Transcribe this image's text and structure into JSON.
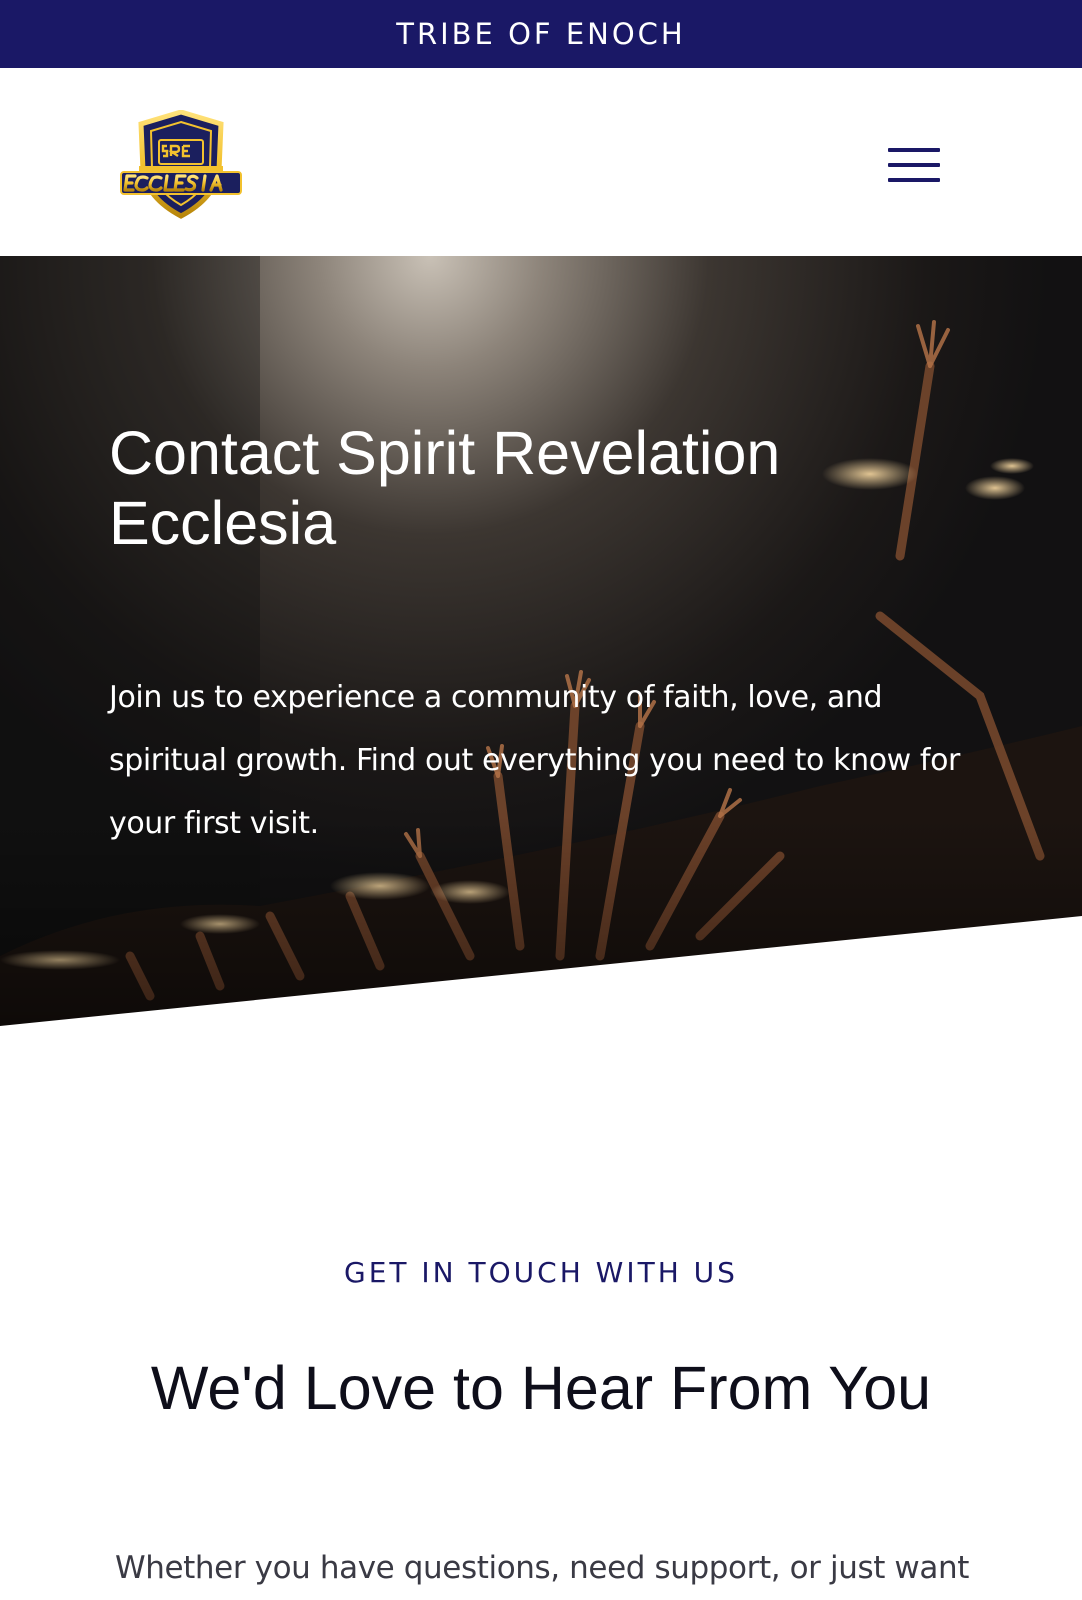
{
  "banner": {
    "text": "TRIBE OF ENOCH"
  },
  "header": {
    "logo_alt": "Spirit Revelation Ecclesia logo",
    "menu_label": "Menu"
  },
  "hero": {
    "title": "Contact Spirit Revelation Ecclesia",
    "description": "Join us to experience a community of faith, love, and spiritual growth. Find out everything you need to know for your first visit."
  },
  "contact": {
    "eyebrow": "GET IN TOUCH WITH US",
    "title": "We'd Love to Hear From You",
    "intro": "Whether you have questions, need support, or just want"
  },
  "colors": {
    "brand_navy": "#1a1866",
    "logo_gold": "#f2c12e",
    "logo_navy": "#1b1f5e"
  }
}
